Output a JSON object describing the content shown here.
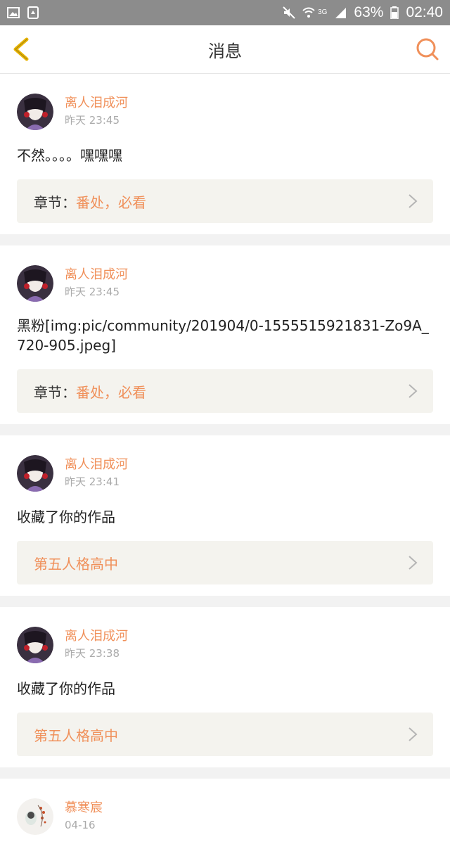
{
  "status_bar": {
    "battery": "63%",
    "time": "02:40",
    "network": "3G"
  },
  "header": {
    "title": "消息"
  },
  "messages": [
    {
      "user": "离人泪成河",
      "time": "昨天 23:45",
      "text": "不然。。。。嘿嘿嘿",
      "ref_prefix": "章节：",
      "ref_title": "番处，必看"
    },
    {
      "user": "离人泪成河",
      "time": "昨天 23:45",
      "text": "黑粉[img:pic/community/201904/0-1555515921831-Zo9A_720-905.jpeg]",
      "ref_prefix": "章节：",
      "ref_title": "番处，必看"
    },
    {
      "user": "离人泪成河",
      "time": "昨天 23:41",
      "text": "收藏了你的作品",
      "ref_prefix": "",
      "ref_title": "第五人格高中"
    },
    {
      "user": "离人泪成河",
      "time": "昨天 23:38",
      "text": "收藏了你的作品",
      "ref_prefix": "",
      "ref_title": "第五人格高中"
    },
    {
      "user": "慕寒宸",
      "time": "04-16"
    }
  ],
  "colors": {
    "accent": "#f0905a",
    "back_icon": "#e8b400",
    "status_bar": "#8c8c8c"
  }
}
